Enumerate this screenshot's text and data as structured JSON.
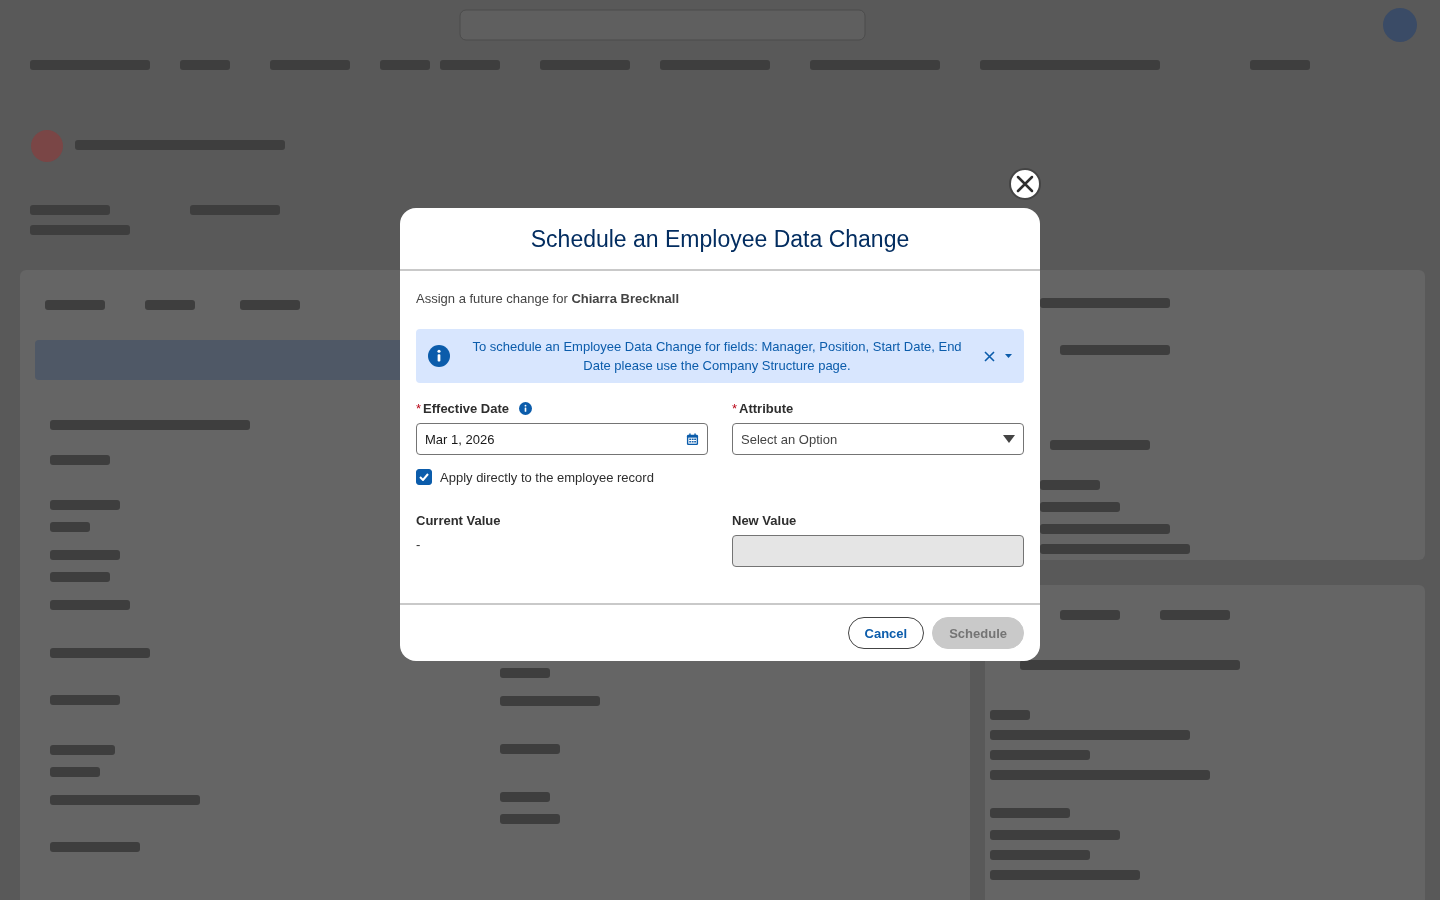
{
  "modal": {
    "title": "Schedule an Employee Data Change",
    "intro": "Assign a future change for **Chiarra Brecknall**",
    "notice": {
      "text": "To schedule an Employee Data Change for fields: Manager, Position, Start Date, End Date please use the Company Structure page."
    },
    "fields": [
      {
        "kind": "date",
        "required_mark": "*",
        "label": "Effective Date",
        "info": true,
        "value": "Mar 1, 2026"
      },
      {
        "kind": "select",
        "required_mark": "*",
        "label": "Attribute",
        "info": false,
        "placeholder": "Select an Option"
      }
    ],
    "apply_directly": {
      "label": "Apply directly to the employee record",
      "checked": true
    },
    "current_value": {
      "label": "Current Value",
      "value": "-"
    },
    "new_value": {
      "label": "New Value",
      "disabled": true
    },
    "buttons": [
      {
        "label": "Cancel",
        "kind": "neutral",
        "disabled": false
      },
      {
        "label": "Schedule",
        "kind": "brand",
        "disabled": true
      }
    ]
  }
}
